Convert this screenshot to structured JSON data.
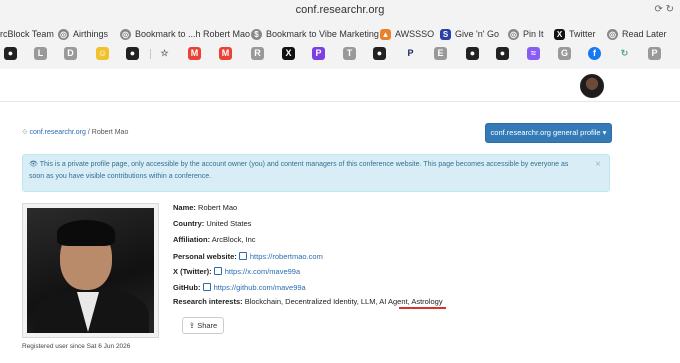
{
  "browser": {
    "url": "conf.researchr.org",
    "bookmarks": [
      {
        "label": "rcBlock Team",
        "icon": "arcblock-icon"
      },
      {
        "label": "Airthings",
        "icon": "globe-icon"
      },
      {
        "label": "Bookmark to ...h Robert Mao",
        "icon": "globe-icon"
      },
      {
        "label": "Bookmark to Vibe Marketing",
        "icon": "dollar-icon"
      },
      {
        "label": "AWSSSO",
        "icon": "aws-cube-icon"
      },
      {
        "label": "Give 'n' Go",
        "icon": "s-logo-icon"
      },
      {
        "label": "Pin It",
        "icon": "globe-icon"
      },
      {
        "label": "Twitter",
        "icon": "x-logo-icon"
      },
      {
        "label": "Read Later",
        "icon": "globe-icon"
      }
    ],
    "icon_row": [
      "github-icon",
      "l-icon",
      "d-icon",
      "emoji-icon",
      "github-icon",
      "star-icon",
      "gmail-icon",
      "gmail-icon",
      "r-icon",
      "x-logo-icon",
      "p-icon",
      "t-icon",
      "github-icon",
      "p-logo-icon",
      "e-icon",
      "github-icon",
      "github-icon",
      "linear-icon",
      "g-icon",
      "facebook-icon",
      "refresh-icon",
      "p-icon"
    ]
  },
  "breadcrumb": {
    "link": "conf.researchr.org",
    "separator": "/",
    "current": "Robert Mao"
  },
  "profile_button": {
    "label": "conf.researchr.org general profile ▾"
  },
  "alert": {
    "text": "This is a private profile page, only accessible by the account owner (you) and content managers of this conference website. This page becomes accessible by everyone as soon as you have visible contributions within a conference.",
    "close": "×"
  },
  "profile": {
    "name_label": "Name:",
    "name": "Robert Mao",
    "country_label": "Country:",
    "country": "United States",
    "affiliation_label": "Affiliation:",
    "affiliation": "ArcBlock, Inc",
    "website_label": "Personal website:",
    "website": "https://robertmao.com",
    "twitter_label": "X (Twitter):",
    "twitter": "https://x.com/mave99a",
    "github_label": "GitHub:",
    "github": "https://github.com/mave99a",
    "interests_label": "Research interests:",
    "interests": "Blockchain, Decentralized Identity, LLM, AI Agent, Astrology"
  },
  "share_label": "Share",
  "footer": "Registered user since Sat 6 Jun 2026"
}
